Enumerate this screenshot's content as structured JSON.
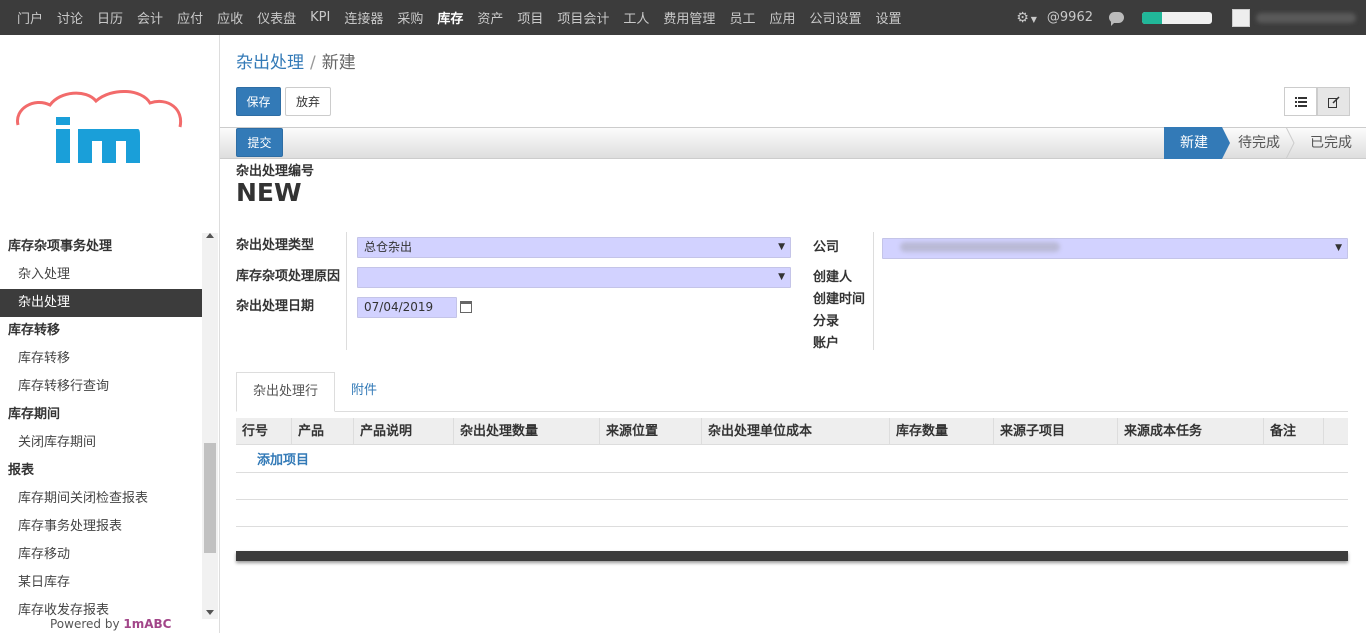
{
  "topnav": {
    "items": [
      "门户",
      "讨论",
      "日历",
      "会计",
      "应付",
      "应收",
      "仪表盘",
      "KPI",
      "连接器",
      "采购",
      "库存",
      "资产",
      "项目",
      "项目会计",
      "工人",
      "费用管理",
      "员工",
      "应用",
      "公司设置",
      "设置"
    ],
    "active_index": 10
  },
  "topright": {
    "gear_icon": "gear-icon",
    "notification_count": "@9962",
    "chat_icon": "chat-icon",
    "progress_fraction": 0.28
  },
  "sidebar": {
    "sections": [
      {
        "title": "库存杂项事务处理",
        "items": [
          "杂入处理",
          "杂出处理"
        ]
      },
      {
        "title": "库存转移",
        "items": [
          "库存转移",
          "库存转移行查询"
        ]
      },
      {
        "title": "库存期间",
        "items": [
          "关闭库存期间"
        ]
      },
      {
        "title": "报表",
        "items": [
          "库存期间关闭检查报表",
          "库存事务处理报表",
          "库存移动",
          "某日库存",
          "库存收发存报表"
        ]
      }
    ],
    "active_item": "杂出处理",
    "powered_prefix": "Powered by ",
    "powered_brand": "1mABC"
  },
  "breadcrumb": {
    "parent": "杂出处理",
    "current": "新建"
  },
  "toolbar": {
    "save_label": "保存",
    "discard_label": "放弃",
    "list_icon": "list-icon",
    "edit_icon": "edit-icon"
  },
  "statusbar": {
    "submit_label": "提交",
    "stages": [
      "新建",
      "待完成",
      "已完成"
    ],
    "active_stage": 0
  },
  "form": {
    "ref_label": "杂出处理编号",
    "ref_value": "NEW",
    "type_label": "杂出处理类型",
    "type_value": "总仓杂出",
    "reason_label": "库存杂项处理原因",
    "reason_value": "",
    "date_label": "杂出处理日期",
    "date_value": "07/04/2019",
    "company_label": "公司",
    "creator_label": "创建人",
    "created_time_label": "创建时间",
    "journal_label": "分录",
    "account_label": "账户"
  },
  "tabs": [
    "杂出处理行",
    "附件"
  ],
  "table": {
    "headers": [
      "行号",
      "产品",
      "产品说明",
      "杂出处理数量",
      "来源位置",
      "杂出处理单位成本",
      "库存数量",
      "来源子项目",
      "来源成本任务",
      "备注"
    ],
    "add_line": "添加项目"
  }
}
